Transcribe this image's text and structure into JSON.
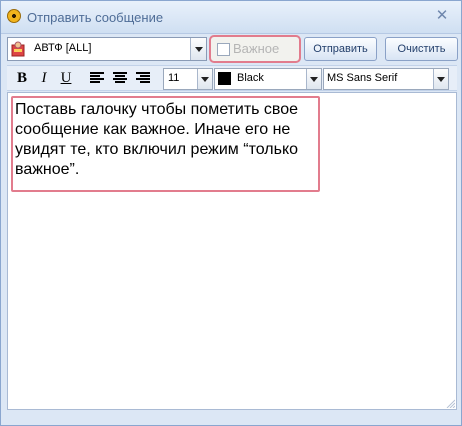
{
  "window": {
    "title": "Отправить сообщение"
  },
  "toolbar": {
    "recipient": "АВТФ [ALL]",
    "important_label": "Важное",
    "important_checked": false,
    "send_label": "Отправить",
    "clear_label": "Очистить"
  },
  "format": {
    "bold": "B",
    "italic": "I",
    "underline": "U",
    "font_size": "11",
    "color_name": "Black",
    "font_name": "MS Sans Serif"
  },
  "editor": {
    "text": "Поставь галочку чтобы пометить свое сообщение как важное. Иначе его не увидят те, кто включил режим “только важное”."
  },
  "colors": {
    "highlight_border": "#e27c8d",
    "title_text": "#4f6d97"
  },
  "icons": {
    "title": "radiation-icon",
    "recipient": "user-icon",
    "close": "close-icon"
  }
}
